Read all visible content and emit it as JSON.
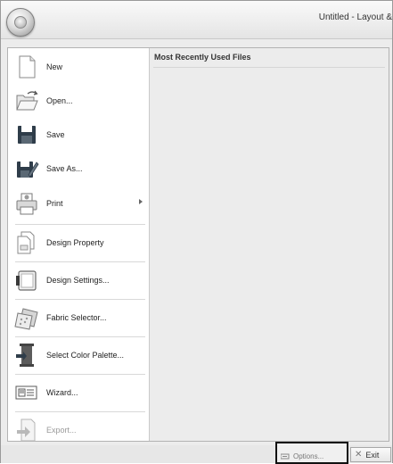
{
  "window": {
    "title": "Untitled - Layout &"
  },
  "menu": {
    "items": [
      {
        "label": "New",
        "icon": "new-document-icon",
        "submenu": false,
        "enabled": true
      },
      {
        "label": "Open...",
        "icon": "open-folder-icon",
        "submenu": false,
        "enabled": true
      },
      {
        "label": "Save",
        "icon": "save-disk-icon",
        "submenu": false,
        "enabled": true
      },
      {
        "label": "Save As...",
        "icon": "save-as-icon",
        "submenu": false,
        "enabled": true
      },
      {
        "label": "Print",
        "icon": "printer-icon",
        "submenu": true,
        "enabled": true
      },
      {
        "label": "Design Property",
        "icon": "design-property-icon",
        "submenu": false,
        "enabled": true
      },
      {
        "label": "Design Settings...",
        "icon": "design-settings-icon",
        "submenu": false,
        "enabled": true
      },
      {
        "label": "Fabric Selector...",
        "icon": "fabric-selector-icon",
        "submenu": false,
        "enabled": true
      },
      {
        "label": "Select Color Palette...",
        "icon": "thread-spool-icon",
        "submenu": false,
        "enabled": true
      },
      {
        "label": "Wizard...",
        "icon": "wizard-icon",
        "submenu": false,
        "enabled": true
      },
      {
        "label": "Export...",
        "icon": "export-icon",
        "submenu": false,
        "enabled": false
      }
    ]
  },
  "mru": {
    "header": "Most Recently Used Files",
    "files": []
  },
  "footer": {
    "options_label": "Options...",
    "exit_label": "Exit"
  },
  "colors": {
    "panel_bg": "#ececec",
    "menu_bg": "#ffffff",
    "highlight_border": "#111111",
    "save_icon": "#2f3d4a"
  }
}
